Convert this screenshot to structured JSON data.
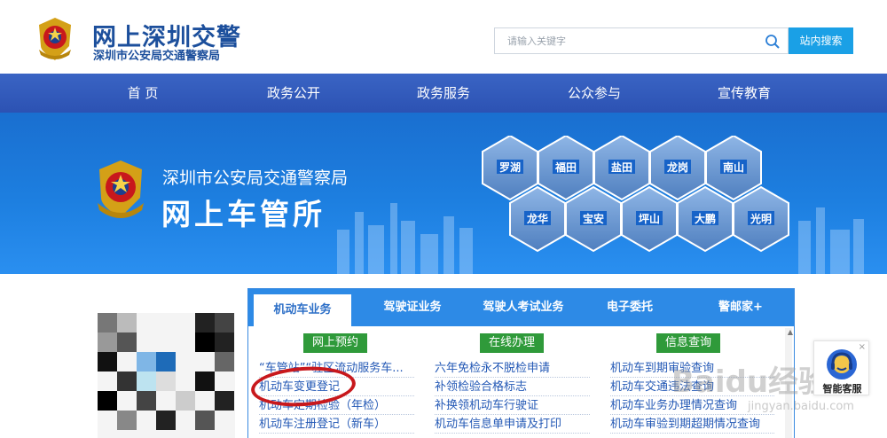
{
  "header": {
    "title": "网上深圳交警",
    "subtitle": "深圳市公安局交通警察局",
    "search_placeholder": "请输入关键字",
    "search_button": "站内搜索"
  },
  "nav": {
    "items": [
      "首 页",
      "政务公开",
      "政务服务",
      "公众参与",
      "宣传教育"
    ]
  },
  "banner": {
    "line1": "深圳市公安局交通警察局",
    "line2": "网上车管所",
    "districts": [
      "罗湖",
      "福田",
      "盐田",
      "龙岗",
      "南山",
      "龙华",
      "宝安",
      "坪山",
      "大鹏",
      "光明"
    ]
  },
  "panel": {
    "tabs": [
      "机动车业务",
      "驾驶证业务",
      "驾驶人考试业务",
      "电子委托",
      "警邮家+"
    ],
    "columns": [
      {
        "head": "网上预约",
        "links": [
          "“车管站”“驻区流动服务车...",
          "机动车变更登记",
          "机动车定期检验（年检）",
          "机动车注册登记（新车）"
        ]
      },
      {
        "head": "在线办理",
        "links": [
          "六年免检永不脱检申请",
          "补领检验合格标志",
          "补换领机动车行驶证",
          "机动车信息单申请及打印"
        ]
      },
      {
        "head": "信息查询",
        "links": [
          "机动车到期审验查询",
          "机动车交通违法查询",
          "机动车业务办理情况查询",
          "机动车审验到期超期情况查询"
        ]
      }
    ]
  },
  "kefu": {
    "label": "智能客服",
    "close": "×"
  },
  "watermark": {
    "main": "Baidu经验",
    "url": "jingyan.baidu.com"
  },
  "colors": {
    "nav": "#2c52b3",
    "tabbar": "#2d8ae6",
    "green_head": "#2f9a3a",
    "link": "#2358b5",
    "annotation": "#c8181c"
  }
}
